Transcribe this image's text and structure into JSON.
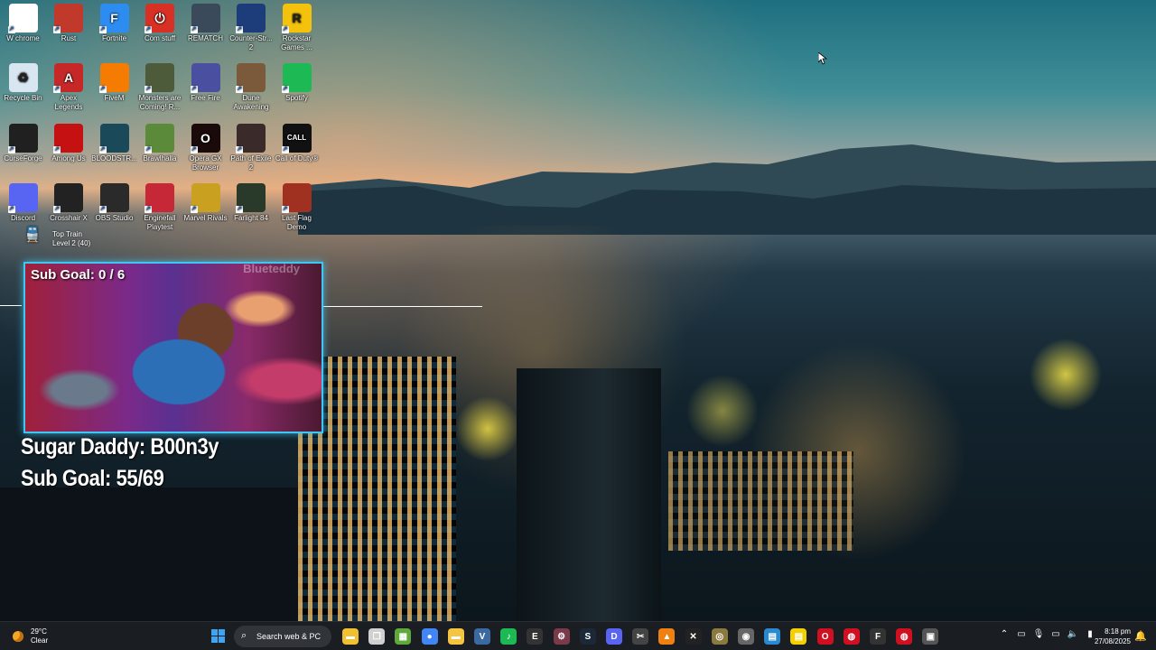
{
  "desktop_icons": [
    {
      "label": "W chrome",
      "icon": "chrome-icon",
      "color": "#ffffff"
    },
    {
      "label": "Rust",
      "icon": "rust-icon",
      "color": "#c0392b"
    },
    {
      "label": "Fortnite",
      "icon": "fortnite-icon",
      "color": "#2d8cf0"
    },
    {
      "label": "Com stuff",
      "icon": "power-icon",
      "color": "#d93025"
    },
    {
      "label": "REMATCH",
      "icon": "rematch-icon",
      "color": "#3a4a5a"
    },
    {
      "label": "Counter-Str... 2",
      "icon": "counter-strike-icon",
      "color": "#1c3d7a"
    },
    {
      "label": "Rockstar Games ...",
      "icon": "rockstar-icon",
      "color": "#f4c20d"
    },
    {
      "label": "Recycle Bin",
      "icon": "recycle-bin-icon",
      "color": "#d8e6f2"
    },
    {
      "label": "Apex Legends",
      "icon": "apex-icon",
      "color": "#c62828"
    },
    {
      "label": "FiveM",
      "icon": "fivem-icon",
      "color": "#f57c00"
    },
    {
      "label": "Monsters are Coming! R...",
      "icon": "monsters-icon",
      "color": "#4e5b3a"
    },
    {
      "label": "Free Fire",
      "icon": "free-fire-icon",
      "color": "#4a4fa0"
    },
    {
      "label": "Dune Awakening",
      "icon": "dune-icon",
      "color": "#7a5a3a"
    },
    {
      "label": "Spotify",
      "icon": "spotify-icon",
      "color": "#1db954"
    },
    {
      "label": "CurseForge",
      "icon": "curseforge-icon",
      "color": "#202020"
    },
    {
      "label": "Among Us",
      "icon": "among-us-icon",
      "color": "#c51111"
    },
    {
      "label": "BLOODSTR...",
      "icon": "bloodstrike-icon",
      "color": "#1a4a5a"
    },
    {
      "label": "Brawlhalla",
      "icon": "brawlhalla-icon",
      "color": "#5a8a3a"
    },
    {
      "label": "Opera GX Browser",
      "icon": "opera-gx-icon",
      "color": "#1a0a0a"
    },
    {
      "label": "Path of Exile 2",
      "icon": "path-of-exile-icon",
      "color": "#3a2a2a"
    },
    {
      "label": "Call of Duty®",
      "icon": "call-of-duty-icon",
      "color": "#111111"
    },
    {
      "label": "Discord",
      "icon": "discord-icon",
      "color": "#5865f2"
    },
    {
      "label": "Crosshair X",
      "icon": "crosshair-icon",
      "color": "#222222"
    },
    {
      "label": "OBS Studio",
      "icon": "obs-icon",
      "color": "#2a2a2a"
    },
    {
      "label": "Enginefall Playtest",
      "icon": "enginefall-icon",
      "color": "#c62838"
    },
    {
      "label": "Marvel Rivals",
      "icon": "marvel-rivals-icon",
      "color": "#c9a020"
    },
    {
      "label": "Farlight 84",
      "icon": "farlight-icon",
      "color": "#2a3a2a"
    },
    {
      "label": "Last Flag Demo",
      "icon": "last-flag-icon",
      "color": "#a03020"
    }
  ],
  "icon_glyphs": [
    "",
    "",
    "F",
    "⏻",
    "",
    "",
    "R",
    "♻",
    "A",
    "",
    "",
    "",
    "",
    "",
    "",
    "",
    "",
    "",
    "O",
    "",
    "CALL",
    "",
    "",
    "",
    "",
    "",
    "",
    ""
  ],
  "train_widget": {
    "title": "Top Train",
    "subtitle": "Level 2  (40)"
  },
  "webcam": {
    "goal_text": "Sub Goal:  0 / 6",
    "watermark": "Blueteddy"
  },
  "overlay": {
    "name_line": "Sugar Daddy: B00n3y",
    "subgoal_line": "Sub Goal: 55/69"
  },
  "taskbar": {
    "weather_temp": "29°C",
    "weather_condition": "Clear",
    "search_placeholder": "Search web & PC",
    "apps": [
      {
        "icon": "file-explorer-icon",
        "color": "#f0c030",
        "glyph": "▬"
      },
      {
        "icon": "task-view-icon",
        "color": "#d0d0d0",
        "glyph": "❐"
      },
      {
        "icon": "minecraft-icon",
        "color": "#5fa83a",
        "glyph": "▦"
      },
      {
        "icon": "chrome-icon",
        "color": "#4285f4",
        "glyph": "●"
      },
      {
        "icon": "folder-icon",
        "color": "#f5c542",
        "glyph": "▬"
      },
      {
        "icon": "visual-studio-icon",
        "color": "#3a6aa0",
        "glyph": "V"
      },
      {
        "icon": "spotify-icon",
        "color": "#1db954",
        "glyph": "♪"
      },
      {
        "icon": "epic-games-icon",
        "color": "#333333",
        "glyph": "E"
      },
      {
        "icon": "settings-gear-icon",
        "color": "#7a3a4a",
        "glyph": "⚙"
      },
      {
        "icon": "steam-icon",
        "color": "#1b2838",
        "glyph": "S"
      },
      {
        "icon": "discord-icon",
        "color": "#5865f2",
        "glyph": "D"
      },
      {
        "icon": "snipping-tool-icon",
        "color": "#444444",
        "glyph": "✂"
      },
      {
        "icon": "vlc-icon",
        "color": "#f08010",
        "glyph": "▲"
      },
      {
        "icon": "capcut-icon",
        "color": "#222222",
        "glyph": "✕"
      },
      {
        "icon": "lol-icon",
        "color": "#8a7a40",
        "glyph": "◎"
      },
      {
        "icon": "chrome-alt-icon",
        "color": "#666666",
        "glyph": "◉"
      },
      {
        "icon": "windows-store-icon",
        "color": "#2a8ad0",
        "glyph": "▤"
      },
      {
        "icon": "sticky-notes-icon",
        "color": "#f5d000",
        "glyph": "▤"
      },
      {
        "icon": "opera-icon",
        "color": "#d01020",
        "glyph": "O"
      },
      {
        "icon": "recording-icon",
        "color": "#d01020",
        "glyph": "◍"
      },
      {
        "icon": "fortnite-icon",
        "color": "#333333",
        "glyph": "F"
      },
      {
        "icon": "opera-gx-icon",
        "color": "#d01020",
        "glyph": "◍"
      },
      {
        "icon": "media-icon",
        "color": "#555555",
        "glyph": "▣"
      }
    ],
    "tray": [
      {
        "icon": "chevron-up-icon",
        "glyph": "⌃"
      },
      {
        "icon": "screen-icon",
        "glyph": "▭"
      },
      {
        "icon": "microphone-icon",
        "glyph": "🎙"
      },
      {
        "icon": "network-icon",
        "glyph": "▭"
      },
      {
        "icon": "volume-icon",
        "glyph": "🔈"
      },
      {
        "icon": "battery-icon",
        "glyph": "▮"
      }
    ],
    "time": "8:18 pm",
    "date": "27/08/2025"
  }
}
